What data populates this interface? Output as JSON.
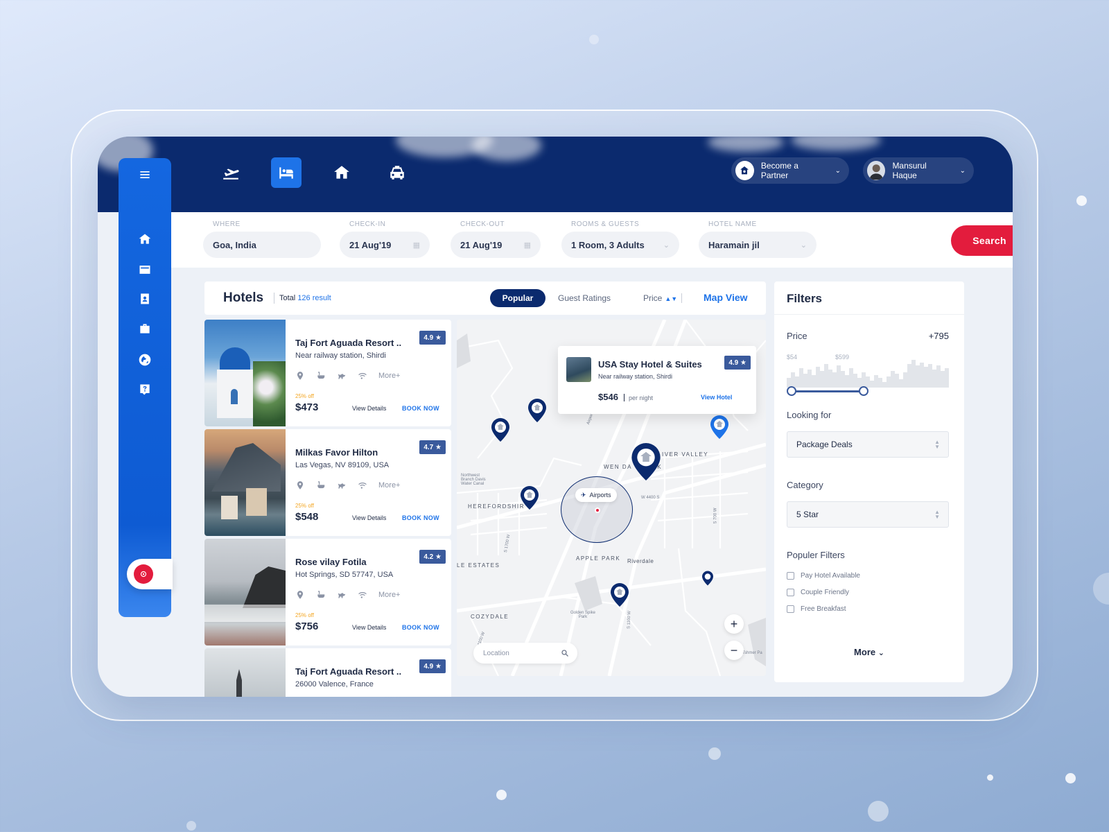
{
  "header": {
    "nav_icons": [
      "flight-icon",
      "hotel-icon",
      "home-icon",
      "car-icon"
    ],
    "active_tab": "hotel",
    "partner_label": "Become a Partner",
    "user_name": "Mansurul Haque"
  },
  "sidebar": {
    "icons": [
      "menu-icon",
      "home-icon",
      "card-icon",
      "contacts-icon",
      "briefcase-icon",
      "globe-icon",
      "help-icon"
    ]
  },
  "search": {
    "where_label": "WHERE",
    "where_value": "Goa, India",
    "checkin_label": "CHECK-IN",
    "checkin_value": "21 Aug'19",
    "checkout_label": "CHECK-OUT",
    "checkout_value": "21 Aug'19",
    "rooms_label": "ROOMS & GUESTS",
    "rooms_value": "1 Room, 3 Adults",
    "hotel_label": "HOTEL NAME",
    "hotel_value": "Haramain jil",
    "button": "Search  Hotel"
  },
  "results": {
    "title": "Hotels",
    "total_prefix": "Total",
    "total_count": "126 result",
    "sort_popular": "Popular",
    "sort_guest": "Guest Ratings",
    "sort_price": "Price",
    "map_view": "Map View"
  },
  "hotels": [
    {
      "name": "Taj Fort Aguada Resort ..",
      "address": "Near railway station, Shirdi",
      "rating": "4.9 ★",
      "discount": "25% off",
      "price": "$473",
      "details": "View Details",
      "book": "BOOK NOW",
      "more": "More+"
    },
    {
      "name": "Milkas Favor Hilton",
      "address": "Las Vegas, NV 89109, USA",
      "rating": "4.7 ★",
      "discount": "25% off",
      "price": "$548",
      "details": "View Details",
      "book": "BOOK NOW",
      "more": "More+"
    },
    {
      "name": "Rose vilay Fotila",
      "address": "Hot Springs, SD 57747, USA",
      "rating": "4.2 ★",
      "discount": "25% off",
      "price": "$756",
      "details": "View Details",
      "book": "BOOK NOW",
      "more": "More+"
    },
    {
      "name": "Taj Fort Aguada Resort ..",
      "address": "26000 Valence, France",
      "rating": "4.9 ★",
      "discount": "",
      "price": "",
      "details": "",
      "book": "",
      "more": ""
    }
  ],
  "map": {
    "popup": {
      "name": "USA Stay Hotel & Suites",
      "address": "Near railway station, Shirdi",
      "rating": "4.9 ★",
      "price": "$546",
      "per": "per night",
      "view": "View Hotel"
    },
    "labels": {
      "river_valley": "IVER VALLEY",
      "wen_dal": "WEN DA",
      "park_rk": "RK",
      "herefordshire": "HEREFORDSHIR",
      "le_estates": "LE ESTATES",
      "apple_park": "APPLE PARK",
      "riverdale": "Riverdale",
      "cozydale": "COZYDALE",
      "northwest": "Northwest Branch Davis Water Canal",
      "golden": "Golden Spike Park",
      "w4400": "W 4400 S",
      "s1700": "S 1700 W",
      "s1100": "S 1100 W",
      "s1100b": "S 1100 W",
      "s700": "S 700 W",
      "airport": "Airport",
      "hammer": "Tshmer Pa"
    },
    "airport_tag": "Airports",
    "search_placeholder": "Location",
    "zoom_in": "+",
    "zoom_out": "−"
  },
  "filters": {
    "title": "Filters",
    "price_label": "Price",
    "price_value": "+795",
    "price_min": "$54",
    "price_max": "$599",
    "price_range": [
      54,
      599
    ],
    "looking_label": "Looking for",
    "looking_value": "Package Deals",
    "category_label": "Category",
    "category_value": "5 Star",
    "popular_label": "Populer Filters",
    "checks": [
      "Pay Hotel Available",
      "Couple Friendly",
      "Free Breakfast"
    ],
    "more": "More"
  },
  "colors": {
    "navy": "#0b2a6e",
    "blue": "#1e73e8",
    "red": "#e31c3d",
    "rating": "#3a5a9c",
    "discount": "#f3a520"
  }
}
